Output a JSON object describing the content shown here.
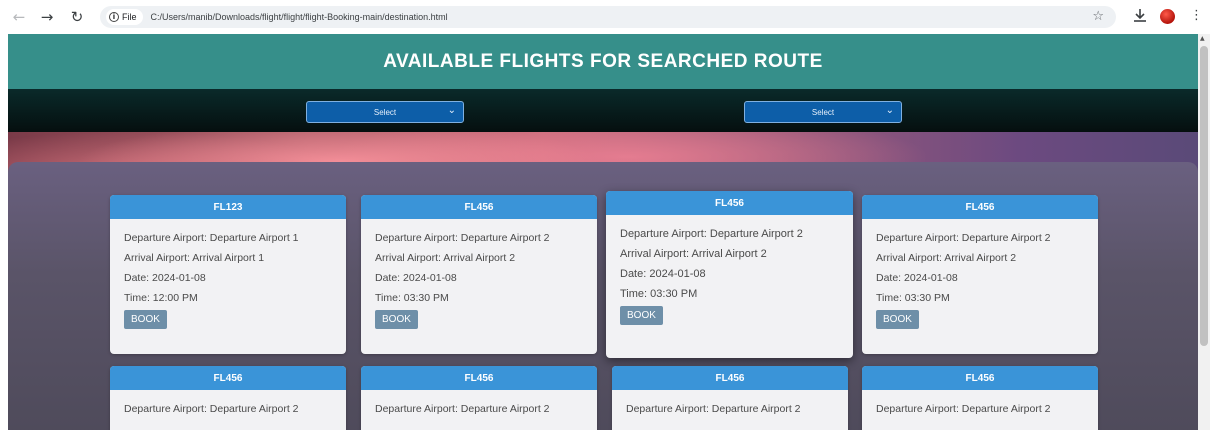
{
  "browser": {
    "back_glyph": "←",
    "forward_glyph": "→",
    "reload_glyph": "↻",
    "site_chip_label": "File",
    "info_glyph": "i",
    "url": "C:/Users/manib/Downloads/flight/flight/flight-Booking-main/destination.html",
    "star_glyph": "☆",
    "menu_glyph": "⋮",
    "icons": [
      "back-arrow-icon",
      "forward-arrow-icon",
      "reload-icon",
      "info-icon",
      "star-icon",
      "download-icon",
      "profile-icon",
      "kebab-menu-icon"
    ]
  },
  "header": {
    "title": "AVAILABLE FLIGHTS FOR SEARCHED ROUTE"
  },
  "filters": {
    "from_select": "Select",
    "to_select": "Select",
    "chevron_glyph": "⌄"
  },
  "flights": [
    {
      "code": "FL123",
      "departure": "Departure Airport: Departure Airport 1",
      "arrival": "Arrival Airport: Arrival Airport 1",
      "date": "Date: 2024-01-08",
      "time": "Time: 12:00 PM",
      "book_label": "BOOK"
    },
    {
      "code": "FL456",
      "departure": "Departure Airport: Departure Airport 2",
      "arrival": "Arrival Airport: Arrival Airport 2",
      "date": "Date: 2024-01-08",
      "time": "Time: 03:30 PM",
      "book_label": "BOOK"
    },
    {
      "code": "FL456",
      "departure": "Departure Airport: Departure Airport 2",
      "arrival": "Arrival Airport: Arrival Airport 2",
      "date": "Date: 2024-01-08",
      "time": "Time: 03:30 PM",
      "book_label": "BOOK"
    },
    {
      "code": "FL456",
      "departure": "Departure Airport: Departure Airport 2",
      "arrival": "Arrival Airport: Arrival Airport 2",
      "date": "Date: 2024-01-08",
      "time": "Time: 03:30 PM",
      "book_label": "BOOK"
    },
    {
      "code": "FL456",
      "departure": "Departure Airport: Departure Airport 2"
    },
    {
      "code": "FL456",
      "departure": "Departure Airport: Departure Airport 2"
    },
    {
      "code": "FL456",
      "departure": "Departure Airport: Departure Airport 2"
    },
    {
      "code": "FL456",
      "departure": "Departure Airport: Departure Airport 2"
    }
  ],
  "colors": {
    "header_teal": "#368f8a",
    "card_header_blue": "#3a94d8",
    "select_blue": "#0d5ea8",
    "book_button": "#6e8fa8"
  }
}
